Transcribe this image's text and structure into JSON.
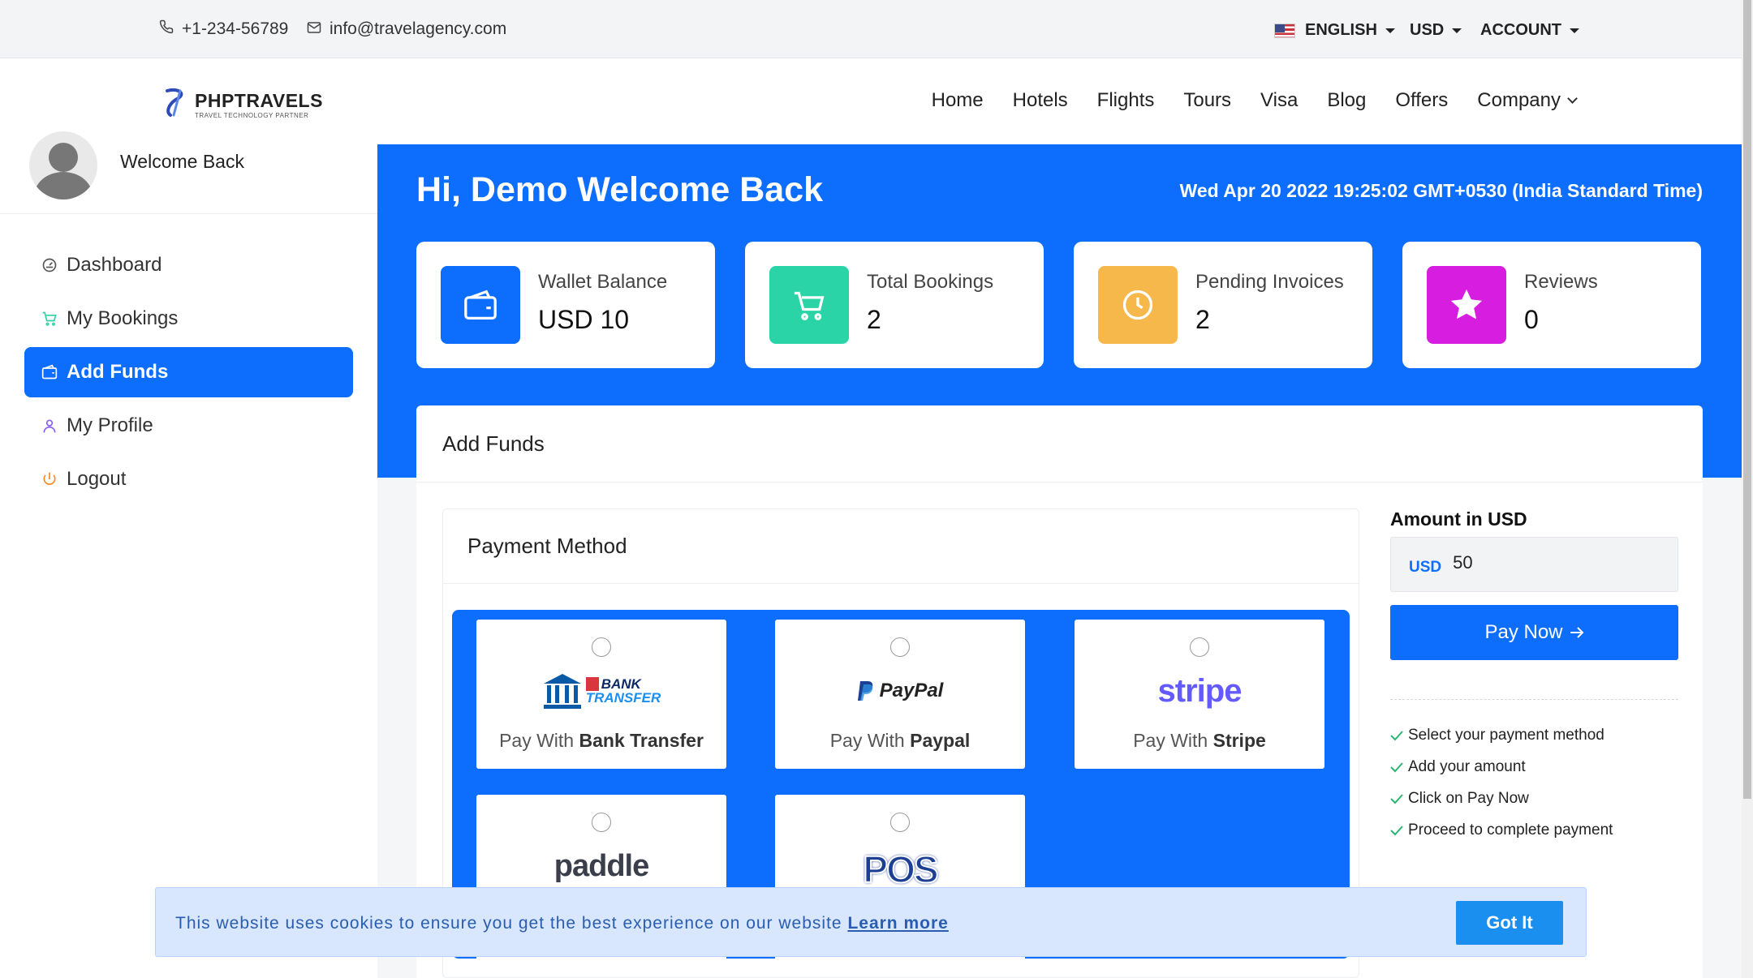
{
  "topbar": {
    "phone": "+1-234-56789",
    "email": "info@travelagency.com",
    "language": "ENGLISH",
    "currency": "USD",
    "account": "ACCOUNT"
  },
  "navbar": {
    "brand": "PHPTRAVELS",
    "tagline": "TRAVEL TECHNOLOGY PARTNER",
    "links": [
      "Home",
      "Hotels",
      "Flights",
      "Tours",
      "Visa",
      "Blog",
      "Offers",
      "Company"
    ]
  },
  "sidebar": {
    "welcome": "Welcome Back",
    "items": [
      {
        "label": "Dashboard",
        "icon": "dashboard-icon"
      },
      {
        "label": "My Bookings",
        "icon": "cart-icon"
      },
      {
        "label": "Add Funds",
        "icon": "wallet-icon",
        "active": true
      },
      {
        "label": "My Profile",
        "icon": "user-icon"
      },
      {
        "label": "Logout",
        "icon": "power-icon"
      }
    ]
  },
  "hero": {
    "greeting": "Hi, Demo Welcome Back",
    "datetime": "Wed Apr 20 2022 19:25:02 GMT+0530 (India Standard Time)"
  },
  "stats": [
    {
      "label": "Wallet Balance",
      "value": "USD 10",
      "color": "#0d6efd",
      "icon": "wallet-icon"
    },
    {
      "label": "Total Bookings",
      "value": "2",
      "color": "#2bd4a6",
      "icon": "cart-icon"
    },
    {
      "label": "Pending Invoices",
      "value": "2",
      "color": "#f7b84b",
      "icon": "clock-icon"
    },
    {
      "label": "Reviews",
      "value": "0",
      "color": "#d71ee0",
      "icon": "star-icon"
    }
  ],
  "add_funds": {
    "title": "Add Funds",
    "payment_method_title": "Payment Method",
    "methods": [
      {
        "prefix": "Pay With",
        "name": "Bank Transfer",
        "logo_line1": "BANK",
        "logo_line2": "TRANSFER"
      },
      {
        "prefix": "Pay With",
        "name": "Paypal",
        "logo": "PayPal"
      },
      {
        "prefix": "Pay With",
        "name": "Stripe",
        "logo": "stripe"
      },
      {
        "logo": "paddle"
      },
      {
        "logo": "POS"
      }
    ],
    "amount_label": "Amount in USD",
    "amount_currency": "USD",
    "amount_value": "50",
    "pay_button": "Pay Now",
    "steps": [
      "Select your payment method",
      "Add your amount",
      "Click on Pay Now",
      "Proceed to complete payment"
    ]
  },
  "cookie": {
    "text": "This website uses cookies to ensure you get the best experience on our website",
    "link": "Learn more",
    "button": "Got It"
  },
  "colors": {
    "primary": "#0d6efd",
    "cookie_bg": "#d8e7fe"
  }
}
